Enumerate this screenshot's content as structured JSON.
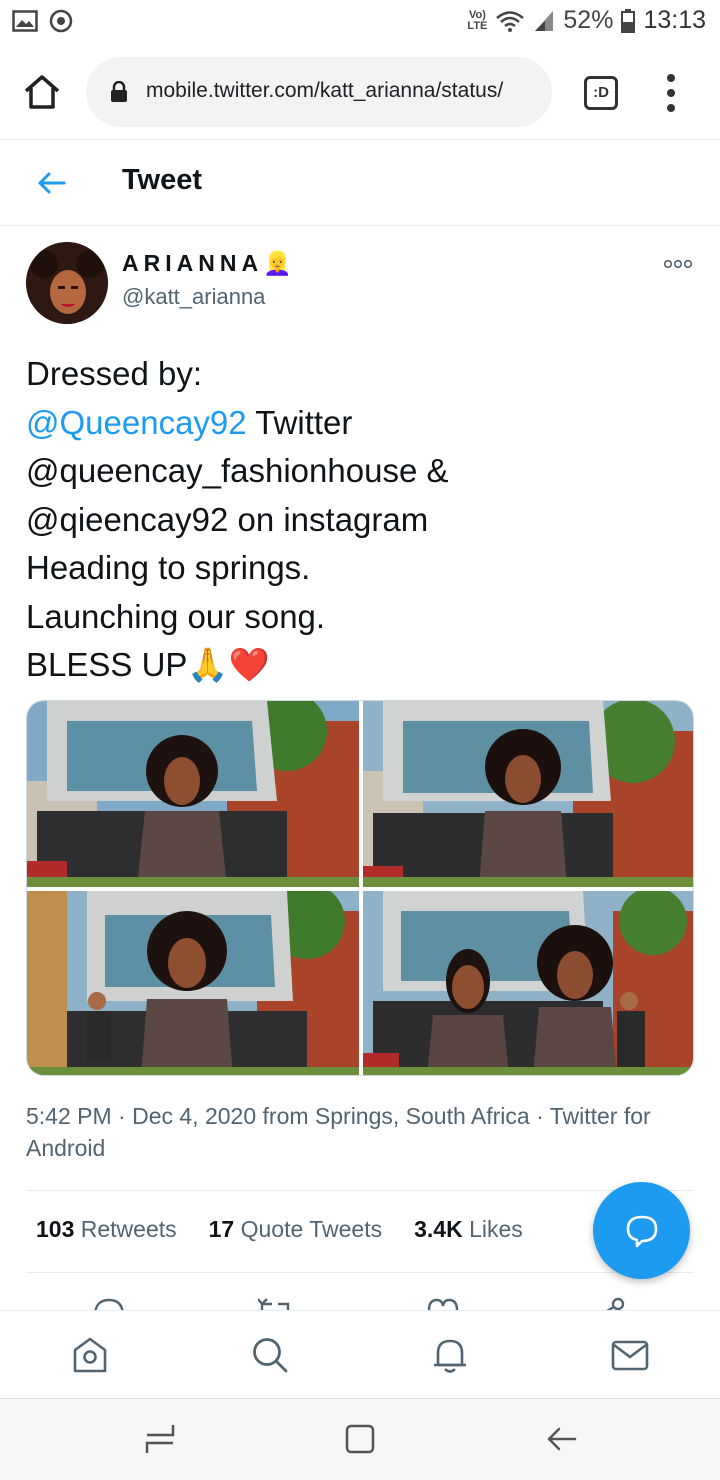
{
  "status_bar": {
    "network": "VoLTE",
    "battery": "52%",
    "time": "13:13"
  },
  "browser": {
    "url": "mobile.twitter.com/katt_arianna/status/",
    "tabs_label": ":D"
  },
  "header": {
    "title": "Tweet"
  },
  "tweet": {
    "display_name": "ARIANNA👱‍♀️",
    "handle": "@katt_arianna",
    "text": {
      "line1": "Dressed by:",
      "line2_mention": "@Queencay92",
      "line2_rest": " Twitter",
      "line3": "@queencay_fashionhouse &",
      "line4": "@qieencay92 on instagram",
      "line5": "Heading to springs.",
      "line6": "Launching our song.",
      "line7": "BLESS UP🙏❤️"
    },
    "meta": {
      "time_date": "5:42 PM · Dec 4, 2020 from Springs, South Africa · ",
      "app": "Twitter for Android"
    },
    "stats": {
      "retweets_count": "103",
      "retweets_label": "Retweets",
      "quotes_count": "17",
      "quotes_label": "Quote Tweets",
      "likes_count": "3.4K",
      "likes_label": "Likes"
    }
  },
  "icons": {
    "home": "home-icon",
    "lock": "lock-icon",
    "tabs": "tabs-icon",
    "menu": "more-vertical-icon",
    "back": "arrow-left-icon",
    "more": "more-horizontal-icon",
    "compose": "compose-message-icon",
    "nav_home": "home-icon",
    "nav_search": "search-icon",
    "nav_notifications": "bell-icon",
    "nav_messages": "mail-icon"
  },
  "colors": {
    "accent": "#1d9bf0",
    "text": "#0f1419",
    "secondary_text": "#536471"
  }
}
